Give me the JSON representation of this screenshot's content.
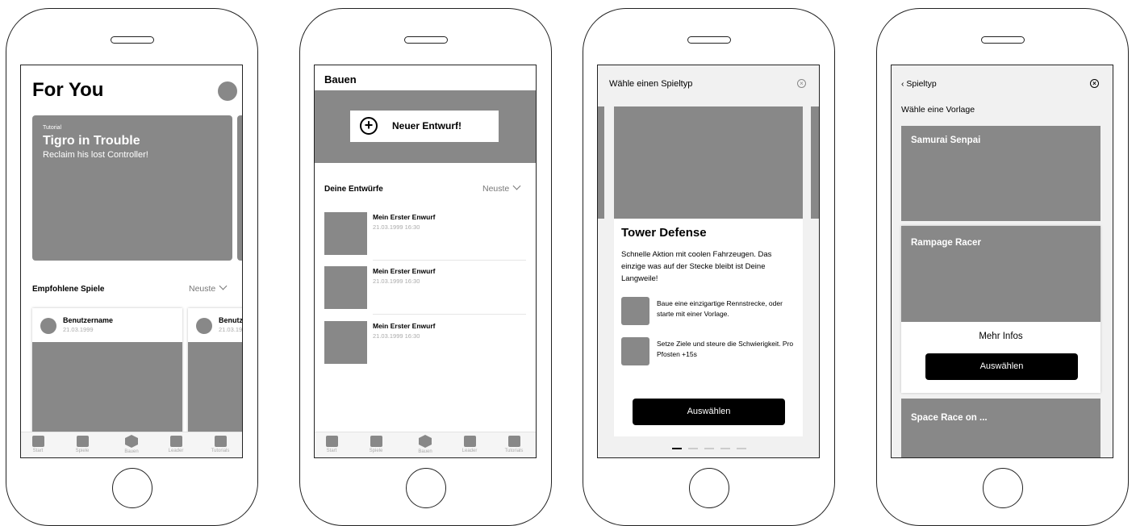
{
  "screen1": {
    "title": "For You",
    "hero": {
      "tag": "Tutorial",
      "title": "Tigro in Trouble",
      "subtitle": "Reclaim his lost Controller!"
    },
    "section_title": "Empfohlene Spiele",
    "sort_label": "Neuste",
    "cards": [
      {
        "user": "Benutzername",
        "date": "21.03.1999"
      },
      {
        "user": "Benutz",
        "date": "21.03.19"
      }
    ]
  },
  "screen2": {
    "title": "Bauen",
    "new_button": "Neuer Entwurf!",
    "section_title": "Deine Entwürfe",
    "sort_label": "Neuste",
    "drafts": [
      {
        "title": "Mein Erster Enwurf",
        "date": "21.03.1999 16:30"
      },
      {
        "title": "Mein Erster Enwurf",
        "date": "21.03.1999 16:30"
      },
      {
        "title": "Mein Erster Enwurf",
        "date": "21.03.1999 16:30"
      }
    ]
  },
  "nav": {
    "items": [
      "Start",
      "Spiele",
      "Bauen",
      "Leader",
      "Tutorials"
    ]
  },
  "screen3": {
    "header": "Wähle einen Spieltyp",
    "card_title": "Tower Defense",
    "card_desc": "Schnelle Aktion mit coolen Fahrzeugen. Das einzige was auf der Stecke bleibt ist Deine Langweile!",
    "features": [
      "Baue eine einzigartige Rennstrecke, oder starte mit einer Vorlage.",
      "Setze Ziele und steure die Schwierigkeit. Pro Pfosten +15s"
    ],
    "button": "Auswählen",
    "page_index": 1,
    "page_count": 5
  },
  "screen4": {
    "back": "Spieltyp",
    "subtitle": "Wähle eine Vorlage",
    "templates": [
      "Samurai Senpai",
      "Rampage Racer",
      "Space Race on ..."
    ],
    "more_info": "Mehr Infos",
    "button": "Auswählen"
  }
}
